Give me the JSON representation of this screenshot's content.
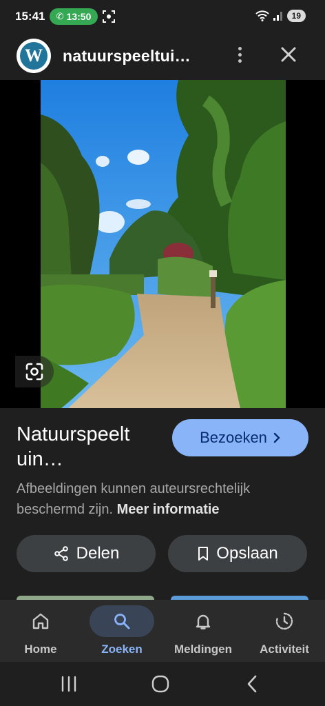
{
  "status_bar": {
    "time": "15:41",
    "call_timer": "13:50",
    "battery": "19"
  },
  "header": {
    "site_title": "natuurspeeltui…",
    "logo_letter": "W"
  },
  "result": {
    "title_line1": "Natuurspeelt",
    "title_line2": "uin…",
    "visit_label": "Bezoeken",
    "copyright_text": "Afbeeldingen kunnen auteursrechtelijk beschermd zijn. ",
    "more_info": "Meer informatie",
    "share_label": "Delen",
    "save_label": "Opslaan"
  },
  "bottom_nav": {
    "items": [
      {
        "label": "Home",
        "icon": "home-icon"
      },
      {
        "label": "Zoeken",
        "icon": "search-icon",
        "active": true
      },
      {
        "label": "Meldingen",
        "icon": "bell-icon"
      },
      {
        "label": "Activiteit",
        "icon": "activity-icon"
      }
    ]
  },
  "colors": {
    "background": "#1f1f1f",
    "accent": "#8ab4f8",
    "call_green": "#34a853",
    "button_surface": "#3c4043"
  }
}
